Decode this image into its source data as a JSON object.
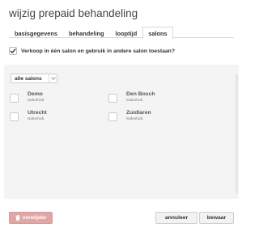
{
  "dialog": {
    "title": "wijzig prepaid behandeling"
  },
  "tabs": [
    {
      "label": "basisgegevens",
      "active": false
    },
    {
      "label": "behandeling",
      "active": false
    },
    {
      "label": "looptijd",
      "active": false
    },
    {
      "label": "salons",
      "active": true
    }
  ],
  "sell_option": {
    "label": "Verkoop in één salon en gebruik in andere salon toestaan?",
    "checked": true
  },
  "filter": {
    "selected": "alle salons",
    "icon": "chevron-down-icon"
  },
  "salons": [
    {
      "name": "Demo",
      "subtitle": "Salonhub",
      "checked": false
    },
    {
      "name": "Den Bosch",
      "subtitle": "Salonhub",
      "checked": false
    },
    {
      "name": "Utrecht",
      "subtitle": "Salonhub",
      "checked": false
    },
    {
      "name": "Zuidlaren",
      "subtitle": "Salonhub",
      "checked": false
    }
  ],
  "footer": {
    "delete_label": "verwijder",
    "delete_icon": "trash-icon",
    "cancel_label": "annuleer",
    "save_label": "bewaar"
  },
  "colors": {
    "delete_button": "#e0a7a7",
    "panel_background": "#f4f4f4"
  }
}
